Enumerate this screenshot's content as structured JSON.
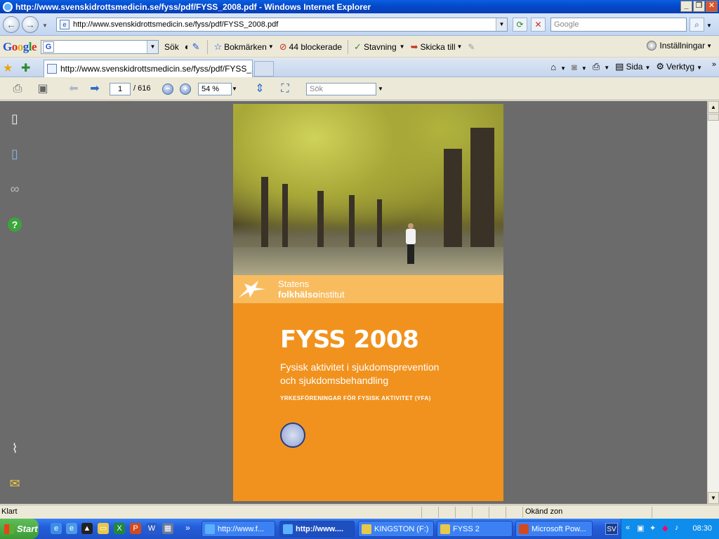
{
  "window": {
    "title": "http://www.svenskidrottsmedicin.se/fyss/pdf/FYSS_2008.pdf - Windows Internet Explorer"
  },
  "address_bar": {
    "url": "http://www.svenskidrottsmedicin.se/fyss/pdf/FYSS_2008.pdf",
    "search_placeholder": "Google"
  },
  "google_toolbar": {
    "logo": "Google",
    "search_label": "Sök",
    "bookmarks_label": "Bokmärken",
    "blocked_label": "44 blockerade",
    "spelling_label": "Stavning",
    "send_label": "Skicka till",
    "settings_label": "Inställningar"
  },
  "tab": {
    "title": "http://www.svenskidrottsmedicin.se/fyss/pdf/FYSS_2..."
  },
  "command_bar": {
    "page_label": "Sida",
    "tools_label": "Verktyg"
  },
  "pdf_toolbar": {
    "current_page": "1",
    "total_pages": "/ 616",
    "zoom": "54 %",
    "search_placeholder": "Sök"
  },
  "document": {
    "org_line1": "Statens",
    "org_line2_bold": "folkhälso",
    "org_line2_rest": "institut",
    "title": "FYSS 2008",
    "subtitle_line1": "Fysisk aktivitet i sjukdomsprevention",
    "subtitle_line2": "och sjukdomsbehandling",
    "publisher": "YRKESFÖRENINGAR FÖR FYSISK AKTIVITET (YFA)"
  },
  "status_bar": {
    "left": "Klart",
    "zone": "Okänd zon"
  },
  "taskbar": {
    "start_label": "Start",
    "items": [
      {
        "label": "http://www.f..."
      },
      {
        "label": "http://www...."
      },
      {
        "label": "KINGSTON (F:)"
      },
      {
        "label": "FYSS 2"
      },
      {
        "label": "Microsoft Pow..."
      }
    ],
    "language": "SV",
    "clock": "08:30"
  },
  "colors": {
    "cover_orange": "#F1921E",
    "band_light_orange": "#F8BC5F",
    "viewer_gray": "#6B6B6B"
  }
}
